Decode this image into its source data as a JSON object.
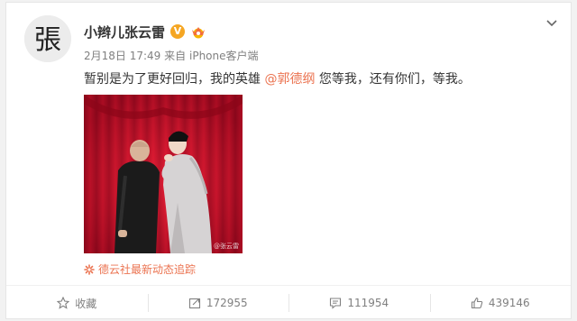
{
  "user": {
    "name": "小辫儿张云雷",
    "avatar_glyph": "張",
    "verified_badge": "V",
    "verified_color": "#f5a623",
    "vip_icon": "vip-crown-icon"
  },
  "meta": {
    "date": "2月18日",
    "time": "17:49",
    "from_label": "来自",
    "client": "iPhone客户端"
  },
  "post": {
    "text_before": "暂别是为了更好回归，我的英雄 ",
    "mention": "@郭德纲",
    "text_after": " 您等我，还有你们，等我。",
    "photo_watermark": "@张云雷"
  },
  "source": {
    "label": "德云社最新动态追踪",
    "icon": "sunburst-icon"
  },
  "actions": {
    "favorite_label": "收藏",
    "repost_count": "172955",
    "comment_count": "111954",
    "like_count": "439146"
  },
  "colors": {
    "accent": "#eb7350",
    "text": "#333333",
    "muted": "#808080",
    "curtain": "#c8102e"
  }
}
